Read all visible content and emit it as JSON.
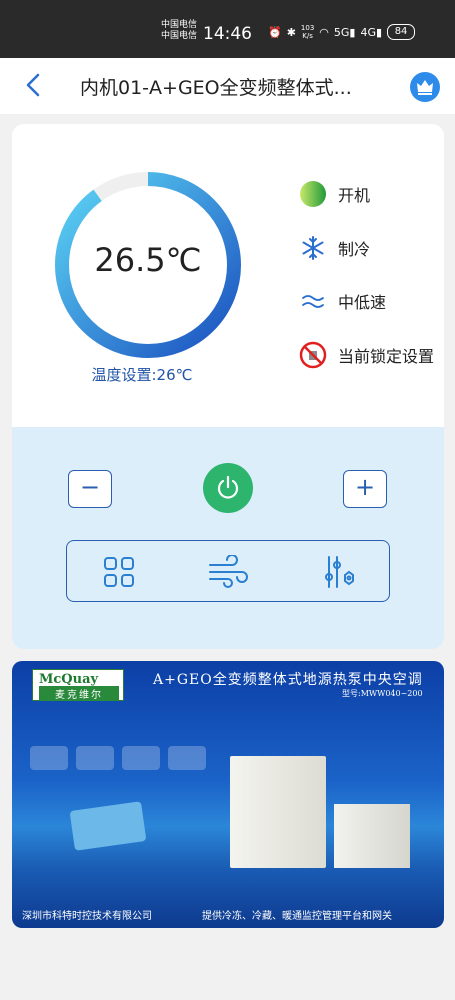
{
  "status_bar": {
    "carrier_1": "中国电信",
    "carrier_2": "中国电信",
    "time": "14:46",
    "net_speed_value": "103",
    "net_speed_unit": "K/s",
    "battery": "84"
  },
  "header": {
    "title": "内机01-A+GEO全变频整体式...",
    "back_icon": "chevron-left-icon",
    "vip_icon": "crown-icon"
  },
  "thermostat": {
    "current_temp": "26.5℃",
    "set_label": "温度设置:26℃",
    "gauge_level_fraction": 0.9,
    "gauge_colors": [
      "#1a4fbf",
      "#5dd6f5"
    ]
  },
  "status": {
    "power": "开机",
    "mode": "制冷",
    "fan_speed": "中低速",
    "lock": "当前锁定设置"
  },
  "controls": {
    "minus": "−",
    "plus": "+",
    "power_icon": "power-icon",
    "tools": [
      "grid-menu-icon",
      "wind-icon",
      "sliders-icon"
    ]
  },
  "banner": {
    "logo_en": "McQuay",
    "logo_cn": "麦克维尔",
    "title": "A+GEO全变频整体式地源热泵中央空调",
    "model": "型号:MWW040~200",
    "footer_left": "深圳市科特时控技术有限公司",
    "footer_right": "提供冷冻、冷藏、暖通监控管理平台和网关"
  },
  "colors": {
    "accent": "#2a5fb0",
    "power_green": "#2db46d",
    "panel_blue": "#dbeefa"
  }
}
